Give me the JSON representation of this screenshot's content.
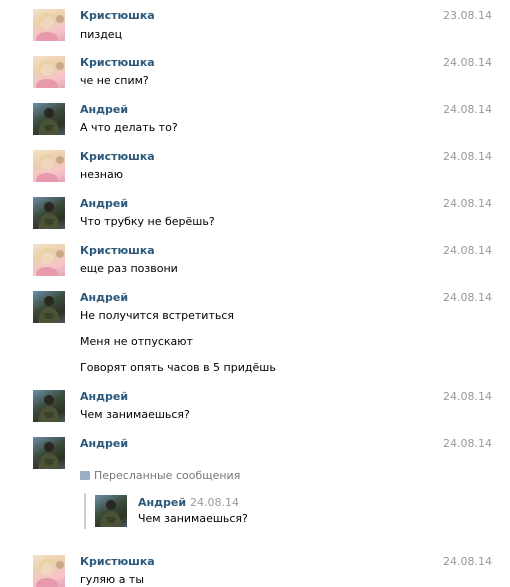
{
  "messages": [
    {
      "author": "Кристюшка",
      "date": "23.08.14",
      "avatar": "female-photo",
      "lines": [
        "пиздец"
      ]
    },
    {
      "author": "Кристюшка",
      "date": "24.08.14",
      "avatar": "female-photo",
      "lines": [
        "че не спим?"
      ]
    },
    {
      "author": "Андрей",
      "date": "24.08.14",
      "avatar": "male-photo",
      "lines": [
        "А что делать то?"
      ]
    },
    {
      "author": "Кристюшка",
      "date": "24.08.14",
      "avatar": "female-photo",
      "lines": [
        "незнаю"
      ]
    },
    {
      "author": "Андрей",
      "date": "24.08.14",
      "avatar": "male-photo",
      "lines": [
        "Что трубку не берёшь?"
      ]
    },
    {
      "author": "Кристюшка",
      "date": "24.08.14",
      "avatar": "female-photo",
      "lines": [
        "еще раз позвони"
      ]
    },
    {
      "author": "Андрей",
      "date": "24.08.14",
      "avatar": "male-photo",
      "lines": [
        "Не получится встретиться",
        "Меня не отпускают",
        "Говорят опять часов в 5 придёшь"
      ]
    },
    {
      "author": "Андрей",
      "date": "24.08.14",
      "avatar": "male-photo",
      "lines": [
        "Чем занимаешься?"
      ]
    },
    {
      "author": "Андрей",
      "date": "24.08.14",
      "avatar": "male-photo",
      "lines": []
    },
    {
      "author": "Кристюшка",
      "date": "24.08.14",
      "avatar": "female-photo",
      "lines": [
        "гуляю а ты"
      ]
    }
  ],
  "forwarded": {
    "header": "Пересланные сообщения",
    "icon": "speech-bubble-icon",
    "author": "Андрей",
    "date": "24.08.14",
    "text": "Чем занимаешься?"
  },
  "colors": {
    "author": "#2b587a",
    "date": "#999999",
    "quote_border": "#c5d0dc"
  }
}
